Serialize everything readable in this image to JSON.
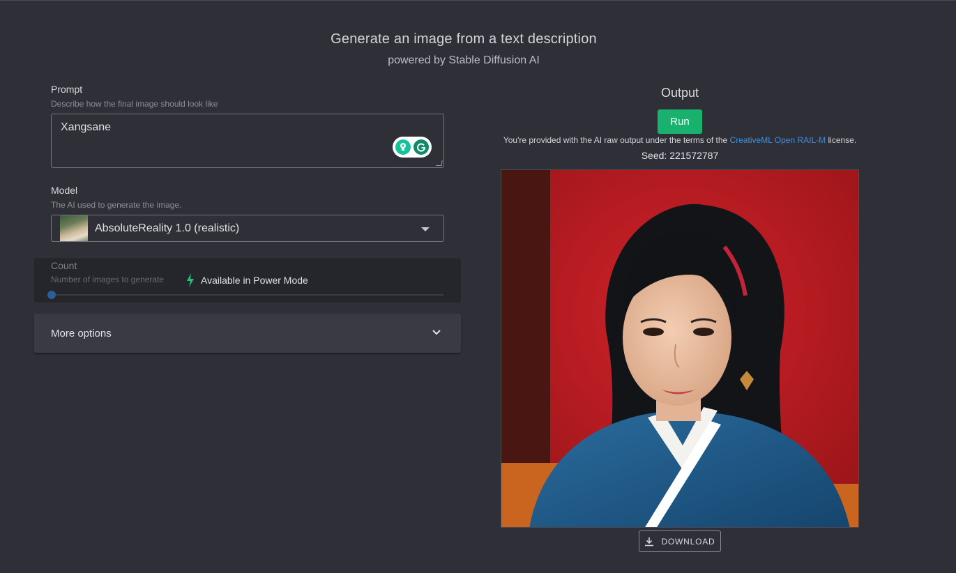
{
  "header": {
    "title": "Generate an image from a text description",
    "subtitle": "powered by Stable Diffusion AI"
  },
  "prompt": {
    "label": "Prompt",
    "help": "Describe how the final image should look like",
    "value": "Xangsane"
  },
  "model": {
    "label": "Model",
    "help": "The AI used to generate the image.",
    "selected": "AbsoluteReality 1.0 (realistic)"
  },
  "count": {
    "label": "Count",
    "help": "Number of images to generate",
    "power_mode_text": "Available in Power Mode",
    "slider_value": 0
  },
  "more_options": {
    "label": "More options"
  },
  "output": {
    "title": "Output",
    "run_label": "Run",
    "license_prefix": "You're provided with the AI raw output under the terms of the",
    "license_link": "CreativeML Open RAIL-M",
    "license_suffix": "license.",
    "seed": "Seed: 221572787",
    "download_label": "DOWNLOAD"
  },
  "colors": {
    "background": "#2f2f38",
    "run_button": "#18b26e",
    "link": "#3f8fe0",
    "power_icon": "#22c27a"
  }
}
